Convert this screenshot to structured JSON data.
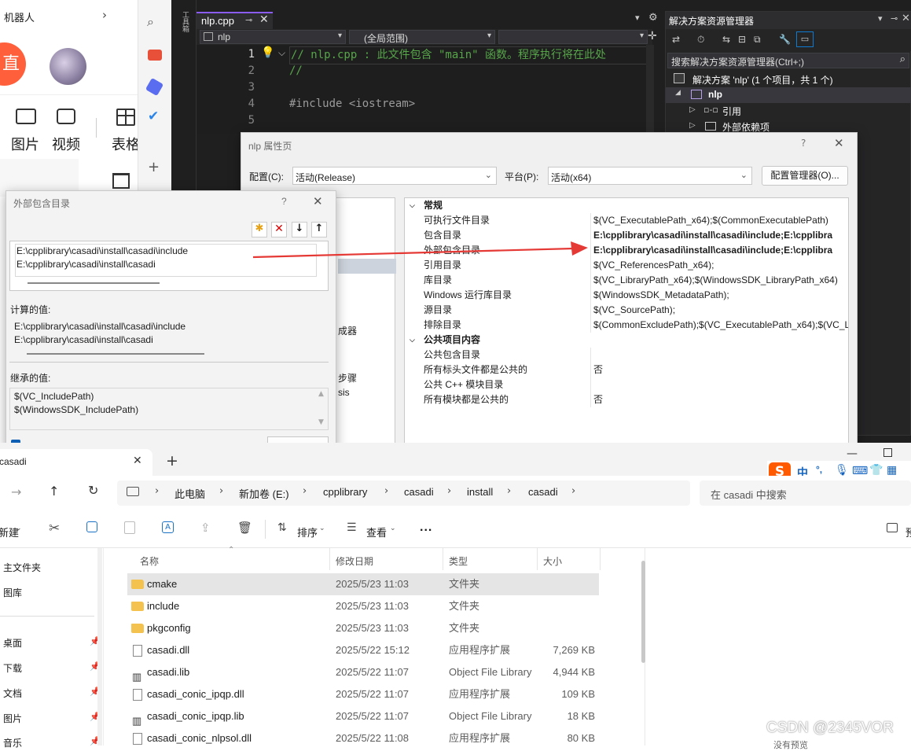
{
  "chat": {
    "top_label": "机器人",
    "btn_char": "直",
    "tools": [
      "图片",
      "视频",
      "表格"
    ]
  },
  "vs": {
    "toolbox_label": "工具箱",
    "tab_title": "nlp.cpp",
    "scope_project": "nlp",
    "scope_range": "(全局范围)",
    "line_numbers": [
      "1",
      "2",
      "3",
      "4",
      "5"
    ],
    "code": {
      "line1": "// nlp.cpp : 此文件包含 \"main\" 函数。程序执行将在此处",
      "line2": "//",
      "line4": "#include <iostream>"
    },
    "solution_explorer": {
      "title": "解决方案资源管理器",
      "search_placeholder": "搜索解决方案资源管理器(Ctrl+;)",
      "solution": "解决方案 'nlp' (1 个项目，共 1 个)",
      "project": "nlp",
      "items": [
        "引用",
        "外部依赖项"
      ]
    }
  },
  "props": {
    "title": "nlp 属性页",
    "config_label": "配置(C):",
    "config_value": "活动(Release)",
    "platform_label": "平台(P):",
    "platform_value": "活动(x64)",
    "config_mgr": "配置管理器(O)...",
    "left_fragments": [
      "成器",
      "步骤",
      "sis"
    ],
    "sections": [
      {
        "header": "常规",
        "rows": [
          {
            "name": "可执行文件目录",
            "value": "$(VC_ExecutablePath_x64);$(CommonExecutablePath)",
            "bold": false
          },
          {
            "name": "包含目录",
            "value": "E:\\cpplibrary\\casadi\\install\\casadi\\include;E:\\cpplibra",
            "bold": true
          },
          {
            "name": "外部包含目录",
            "value": "E:\\cpplibrary\\casadi\\install\\casadi\\include;E:\\cpplibra",
            "bold": true
          },
          {
            "name": "引用目录",
            "value": "$(VC_ReferencesPath_x64);",
            "bold": false
          },
          {
            "name": "库目录",
            "value": "$(VC_LibraryPath_x64);$(WindowsSDK_LibraryPath_x64)",
            "bold": false
          },
          {
            "name": "Windows 运行库目录",
            "value": "$(WindowsSDK_MetadataPath);",
            "bold": false
          },
          {
            "name": "源目录",
            "value": "$(VC_SourcePath);",
            "bold": false
          },
          {
            "name": "排除目录",
            "value": "$(CommonExcludePath);$(VC_ExecutablePath_x64);$(VC_L",
            "bold": false
          }
        ]
      },
      {
        "header": "公共项目内容",
        "rows": [
          {
            "name": "公共包含目录",
            "value": "",
            "bold": false
          },
          {
            "name": "所有标头文件都是公共的",
            "value": "否",
            "bold": false
          },
          {
            "name": "公共 C++ 模块目录",
            "value": "",
            "bold": false
          },
          {
            "name": "所有模块都是公共的",
            "value": "否",
            "bold": false
          }
        ]
      }
    ]
  },
  "extdlg": {
    "title": "外部包含目录",
    "help": "?",
    "entries": [
      "E:\\cpplibrary\\casadi\\install\\casadi\\include",
      "E:\\cpplibrary\\casadi\\install\\casadi"
    ],
    "computed_label": "计算的值:",
    "computed": [
      "E:\\cpplibrary\\casadi\\install\\casadi\\include",
      "E:\\cpplibrary\\casadi\\install\\casadi"
    ],
    "inherited_label": "继承的值:",
    "inherited": [
      "$(VC_IncludePath)",
      "$(WindowsSDK_IncludePath)"
    ]
  },
  "explorer": {
    "tab_title": "casadi",
    "breadcrumb": [
      "此电脑",
      "新加卷 (E:)",
      "cpplibrary",
      "casadi",
      "install",
      "casadi"
    ],
    "search_placeholder": "在 casadi 中搜索",
    "toolbar": {
      "new": "新建",
      "sort": "排序",
      "view": "查看",
      "more": "...",
      "preview": "预"
    },
    "columns": [
      "名称",
      "修改日期",
      "类型",
      "大小"
    ],
    "nav": [
      "主文件夹",
      "图库",
      "桌面",
      "下载",
      "文档",
      "图片",
      "音乐"
    ],
    "files": [
      {
        "name": "cmake",
        "date": "2025/5/23 11:03",
        "type": "文件夹",
        "size": "",
        "icon": "folder"
      },
      {
        "name": "include",
        "date": "2025/5/23 11:03",
        "type": "文件夹",
        "size": "",
        "icon": "folder"
      },
      {
        "name": "pkgconfig",
        "date": "2025/5/23 11:03",
        "type": "文件夹",
        "size": "",
        "icon": "folder"
      },
      {
        "name": "casadi.dll",
        "date": "2025/5/22 15:12",
        "type": "应用程序扩展",
        "size": "7,269 KB",
        "icon": "dll"
      },
      {
        "name": "casadi.lib",
        "date": "2025/5/22 11:07",
        "type": "Object File Library",
        "size": "4,944 KB",
        "icon": "lib"
      },
      {
        "name": "casadi_conic_ipqp.dll",
        "date": "2025/5/22 11:07",
        "type": "应用程序扩展",
        "size": "109 KB",
        "icon": "dll"
      },
      {
        "name": "casadi_conic_ipqp.lib",
        "date": "2025/5/22 11:07",
        "type": "Object File Library",
        "size": "18 KB",
        "icon": "lib"
      },
      {
        "name": "casadi_conic_nlpsol.dll",
        "date": "2025/5/22 11:08",
        "type": "应用程序扩展",
        "size": "80 KB",
        "icon": "dll"
      }
    ],
    "preview_hint": "没有预览"
  },
  "ime": {
    "lang": "中",
    "punct": "°,"
  },
  "watermark": "CSDN @2345VOR",
  "colors": {
    "vs_bg": "#1f1f1f",
    "accent": "#0078d4",
    "arrow": "#e53935",
    "sogou": "#ff5a00"
  }
}
